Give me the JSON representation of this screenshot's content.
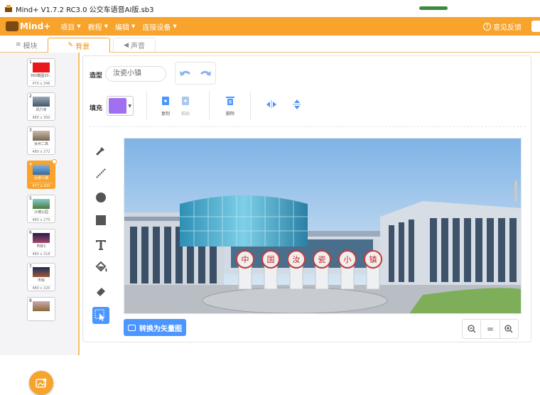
{
  "window": {
    "title": "Mind+ V1.7.2 RC3.0  公交车语音AI版.sb3",
    "progress": 1.0
  },
  "menu": {
    "logo": "Mind+",
    "items": [
      {
        "label": "项目"
      },
      {
        "label": "教程"
      },
      {
        "label": "编辑"
      },
      {
        "label": "连接设备"
      }
    ],
    "feedback": "意见反馈"
  },
  "tabs": [
    {
      "label": "模块",
      "icon": "blocks-icon"
    },
    {
      "label": "背景",
      "icon": "brush-icon"
    },
    {
      "label": "声音",
      "icon": "speaker-icon"
    }
  ],
  "backdrops": [
    {
      "num": "1",
      "name": "360截图20...",
      "size": "470 x 346",
      "color": "#e8181c"
    },
    {
      "num": "2",
      "name": "风穴寺",
      "size": "480 x 300",
      "color": "#6a7a86"
    },
    {
      "num": "3",
      "name": "汝州二高",
      "size": "480 x 272",
      "color": "#8a7a5a"
    },
    {
      "num": "4",
      "name": "汝瓷小镇",
      "size": "477 x 320",
      "color": "#4d8fc4"
    },
    {
      "num": "5",
      "name": "沙滩公园",
      "size": "480 x 270",
      "color": "#5c8a4a"
    },
    {
      "num": "6",
      "name": "市标1",
      "size": "480 x 318",
      "color": "#3a2a5a"
    },
    {
      "num": "7",
      "name": "市标",
      "size": "480 x 320",
      "color": "#3a4a7a"
    },
    {
      "num": "8",
      "name": "",
      "size": "",
      "color": "#8a6a3a"
    }
  ],
  "editor": {
    "shape_label": "造型",
    "shape_name": "汝瓷小镇",
    "fill_label": "填充",
    "fill_color": "#a070f0",
    "tools": [
      {
        "label": "复制"
      },
      {
        "label": "粘贴"
      },
      {
        "label": "删除"
      }
    ],
    "convert_label": "转换为矢量图",
    "zoom_reset": "="
  },
  "sign_chars": [
    "中",
    "国",
    "汝",
    "瓷",
    "小",
    "镇"
  ]
}
